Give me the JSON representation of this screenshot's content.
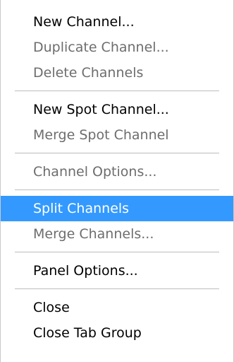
{
  "menu": {
    "groups": [
      {
        "items": [
          {
            "label": "New Channel...",
            "state": "enabled"
          },
          {
            "label": "Duplicate Channel...",
            "state": "disabled"
          },
          {
            "label": "Delete Channels",
            "state": "disabled"
          }
        ]
      },
      {
        "items": [
          {
            "label": "New Spot Channel...",
            "state": "enabled"
          },
          {
            "label": "Merge Spot Channel",
            "state": "disabled"
          }
        ]
      },
      {
        "items": [
          {
            "label": "Channel Options...",
            "state": "disabled"
          }
        ]
      },
      {
        "items": [
          {
            "label": "Split Channels",
            "state": "highlighted"
          },
          {
            "label": "Merge Channels...",
            "state": "disabled"
          }
        ]
      },
      {
        "items": [
          {
            "label": "Panel Options...",
            "state": "enabled"
          }
        ]
      },
      {
        "items": [
          {
            "label": "Close",
            "state": "enabled"
          },
          {
            "label": "Close Tab Group",
            "state": "enabled"
          }
        ]
      }
    ]
  },
  "colors": {
    "highlight": "#3399ff",
    "disabled_text": "#6d6d6d",
    "separator": "#bdbdbd"
  }
}
